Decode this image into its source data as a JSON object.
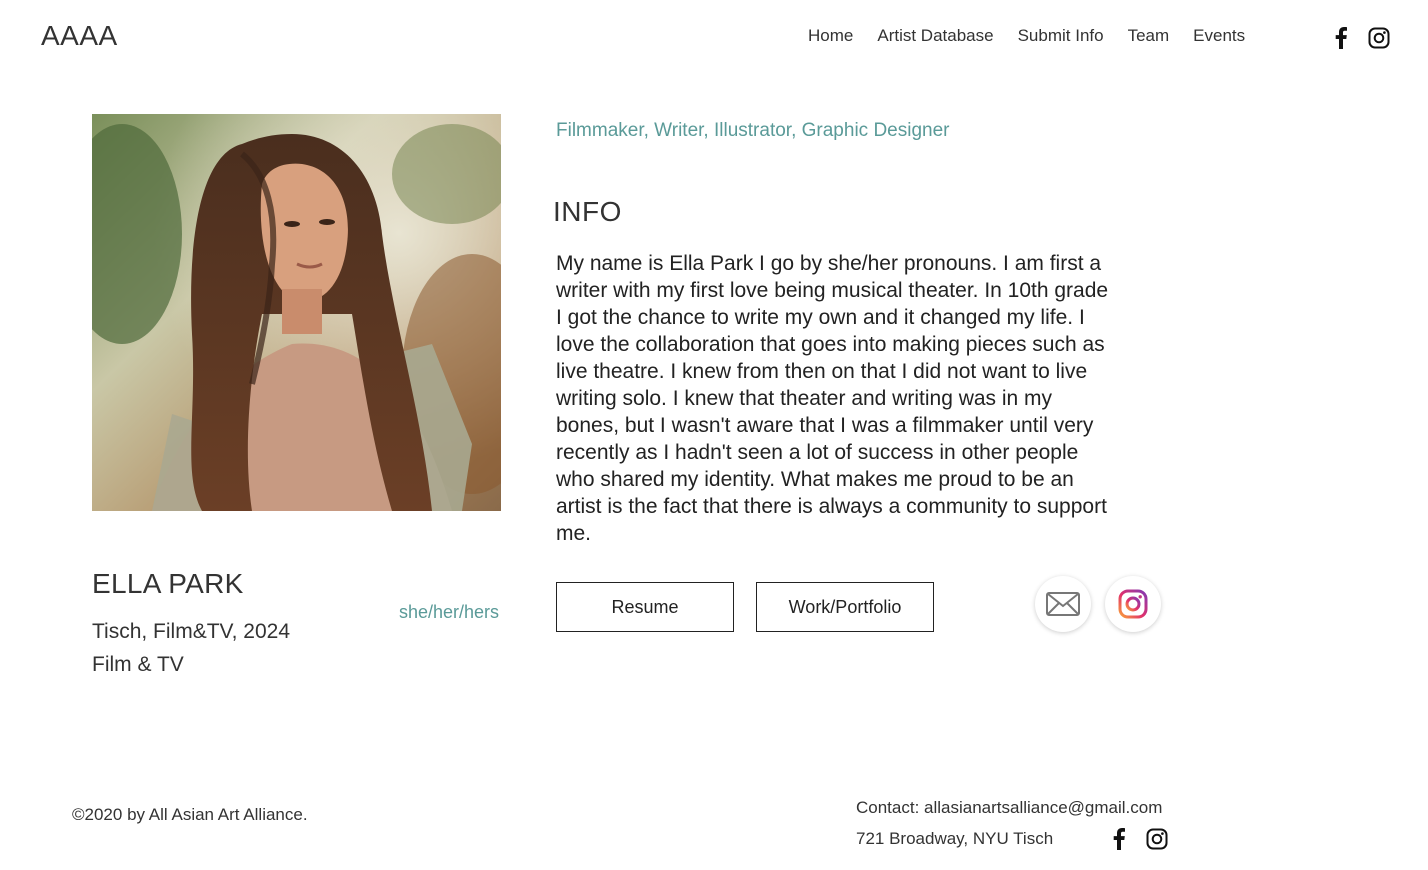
{
  "header": {
    "logo": "AAAA",
    "nav": [
      "Home",
      "Artist Database",
      "Submit Info",
      "Team",
      "Events"
    ],
    "social_icons": [
      "facebook-icon",
      "instagram-icon"
    ]
  },
  "profile": {
    "roles": "Filmmaker, Writer, Illustrator, Graphic Designer",
    "info_heading": "INFO",
    "bio": "My name is Ella Park I go by she/her pronouns. I am first a writer with my first love being musical theater. In 10th grade I got the chance to write my own and it changed my life. I love the collaboration that goes into making pieces such as live theatre. I knew from then on that I did not want to live writing solo. I knew that theater and writing was in my bones, but I wasn't aware that I was a filmmaker until very recently as I hadn't seen a lot of success in other people who shared my identity. What makes me proud to be an artist is the fact that there is always a community to support me.",
    "name": "ELLA PARK",
    "pronouns": "she/her/hers",
    "school": "Tisch, Film&TV, 2024",
    "program": "Film & TV",
    "buttons": {
      "resume": "Resume",
      "portfolio": "Work/Portfolio"
    },
    "contact_icons": [
      "mail-icon",
      "instagram-icon"
    ]
  },
  "footer": {
    "copyright": "©2020 by All Asian Art Alliance.",
    "contact": "Contact: allasianartsalliance@gmail.com",
    "address": "721 Broadway, NYU Tisch"
  },
  "colors": {
    "accent_teal": "#5a9a98",
    "text_dark": "#222222",
    "background": "#ffffff"
  }
}
